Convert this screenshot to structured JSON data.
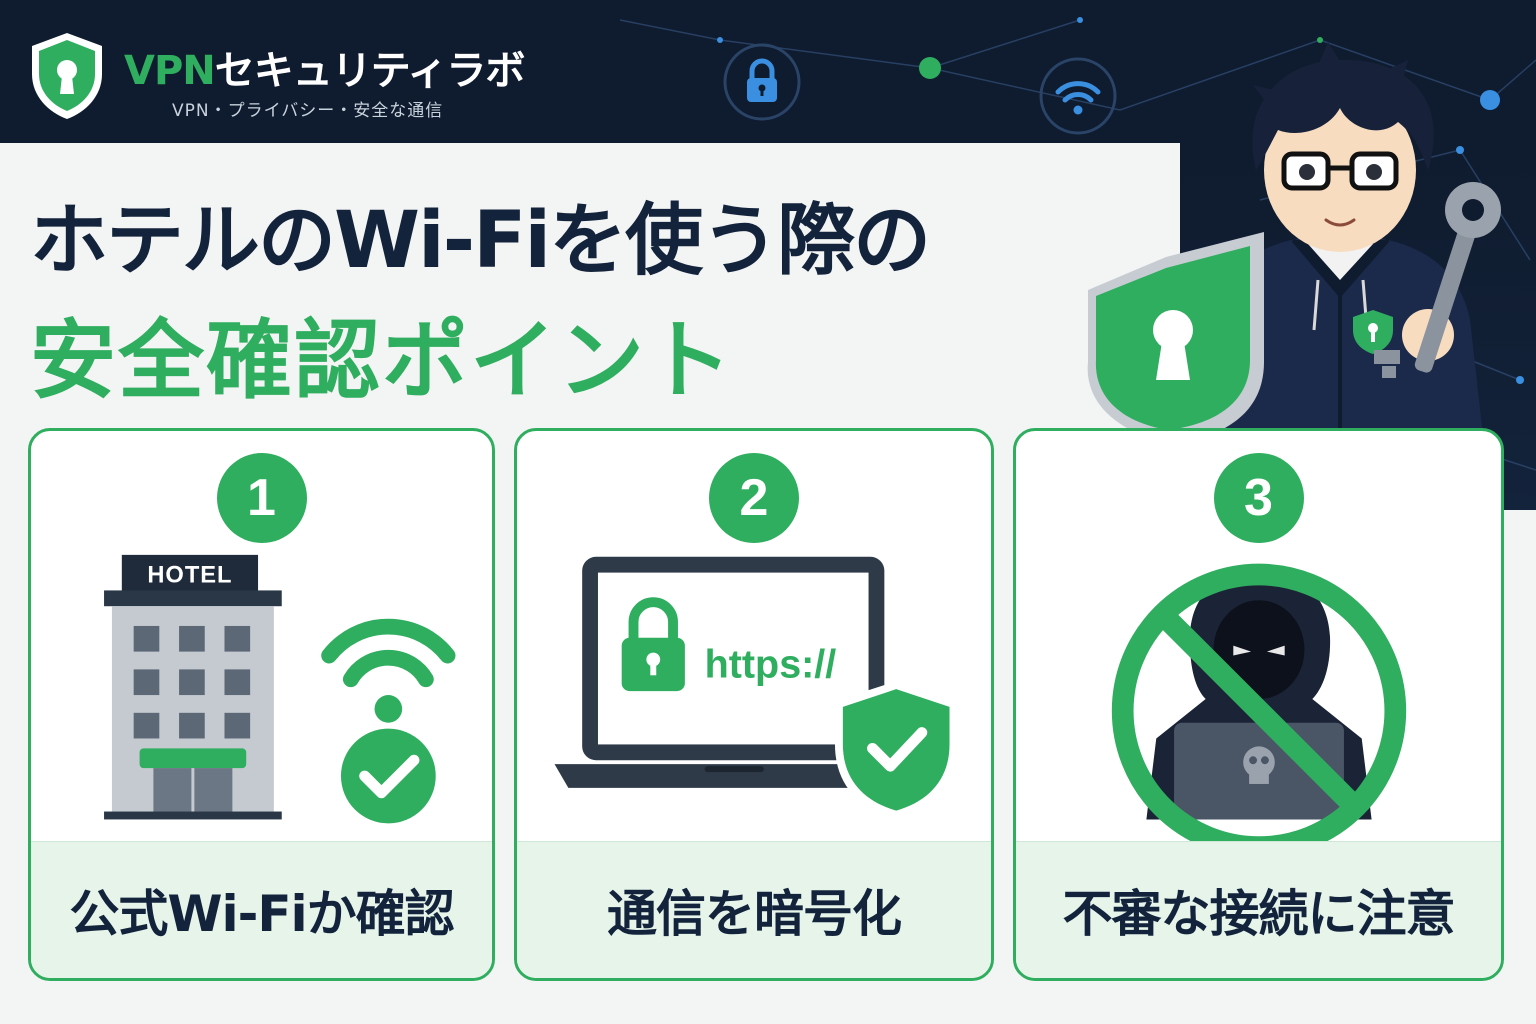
{
  "brand": {
    "name_accent": "VPN",
    "name_rest": "セキュリティラボ",
    "tagline": "VPN・プライバシー・安全な通信"
  },
  "title": {
    "line1": "ホテルのWi-Fiを使う際の",
    "line2": "安全確認ポイント"
  },
  "cards": [
    {
      "number": "1",
      "hotel_sign": "HOTEL",
      "label": "公式Wi-Fiか確認"
    },
    {
      "number": "2",
      "url_text": "https://",
      "label": "通信を暗号化"
    },
    {
      "number": "3",
      "label": "不審な接続に注意"
    }
  ],
  "icons": {
    "header": [
      "lock-icon",
      "wifi-icon"
    ],
    "card1": [
      "hotel-building-icon",
      "wifi-icon",
      "check-circle-icon"
    ],
    "card2": [
      "laptop-icon",
      "padlock-icon",
      "shield-check-icon"
    ],
    "card3": [
      "prohibited-icon",
      "hooded-hacker-icon",
      "skull-icon"
    ]
  },
  "colors": {
    "accent_green": "#2fae5f",
    "navy": "#13233b",
    "header_bg": "#0f1b2e",
    "panel_bg": "#e6f4ea"
  }
}
